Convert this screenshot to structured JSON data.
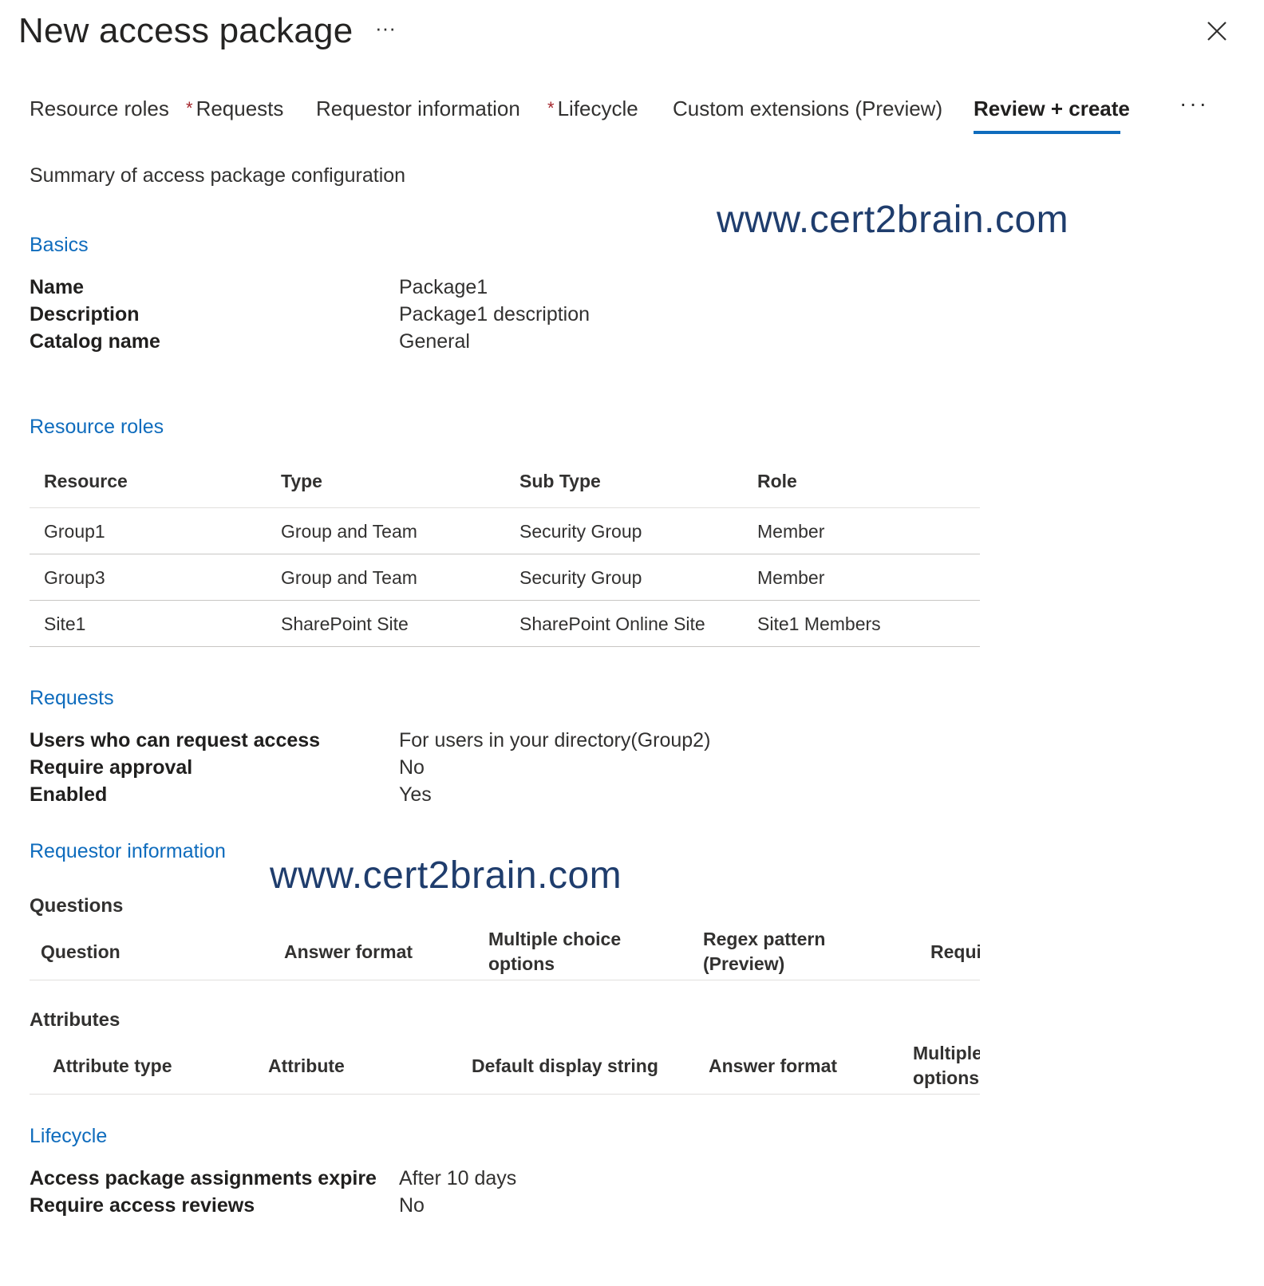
{
  "header": {
    "title": "New access package",
    "more_label": "···",
    "close_icon": "close-icon"
  },
  "tabs": [
    {
      "label": "Resource roles",
      "required": false
    },
    {
      "label": "Requests",
      "required": true
    },
    {
      "label": "Requestor information",
      "required": false
    },
    {
      "label": "Lifecycle",
      "required": true
    },
    {
      "label": "Custom extensions (Preview)",
      "required": false
    },
    {
      "label": "Review + create",
      "required": false,
      "active": true
    }
  ],
  "tabs_more_label": "···",
  "required_marker": "*",
  "summary": "Summary of access package configuration",
  "watermark": "www.cert2brain.com",
  "basics": {
    "heading": "Basics",
    "rows": [
      {
        "label": "Name",
        "value": "Package1"
      },
      {
        "label": "Description",
        "value": "Package1 description"
      },
      {
        "label": "Catalog name",
        "value": "General"
      }
    ]
  },
  "resource_roles": {
    "heading": "Resource roles",
    "columns": [
      "Resource",
      "Type",
      "Sub Type",
      "Role"
    ],
    "rows": [
      [
        "Group1",
        "Group and Team",
        "Security Group",
        "Member"
      ],
      [
        "Group3",
        "Group and Team",
        "Security Group",
        "Member"
      ],
      [
        "Site1",
        "SharePoint Site",
        "SharePoint Online Site",
        "Site1 Members"
      ]
    ]
  },
  "requests": {
    "heading": "Requests",
    "rows": [
      {
        "label": "Users who can request access",
        "value": "For users in your directory(Group2)"
      },
      {
        "label": "Require approval",
        "value": "No"
      },
      {
        "label": "Enabled",
        "value": "Yes"
      }
    ]
  },
  "requestor_information": {
    "heading": "Requestor information",
    "questions_heading": "Questions",
    "question_columns": [
      "Question",
      "Answer format",
      "Multiple choice",
      "options",
      "Regex pattern",
      "(Preview)",
      "Requi"
    ],
    "attributes_heading": "Attributes",
    "attribute_columns": [
      "Attribute type",
      "Attribute",
      "Default display string",
      "Answer format",
      "Multiple",
      "options"
    ]
  },
  "lifecycle": {
    "heading": "Lifecycle",
    "rows": [
      {
        "label": "Access package assignments expire",
        "value": "After 10 days"
      },
      {
        "label": "Require access reviews",
        "value": "No"
      }
    ]
  },
  "colors": {
    "accent": "#0f6cbd",
    "required": "#a4262c",
    "watermark": "#1f3d6d"
  }
}
